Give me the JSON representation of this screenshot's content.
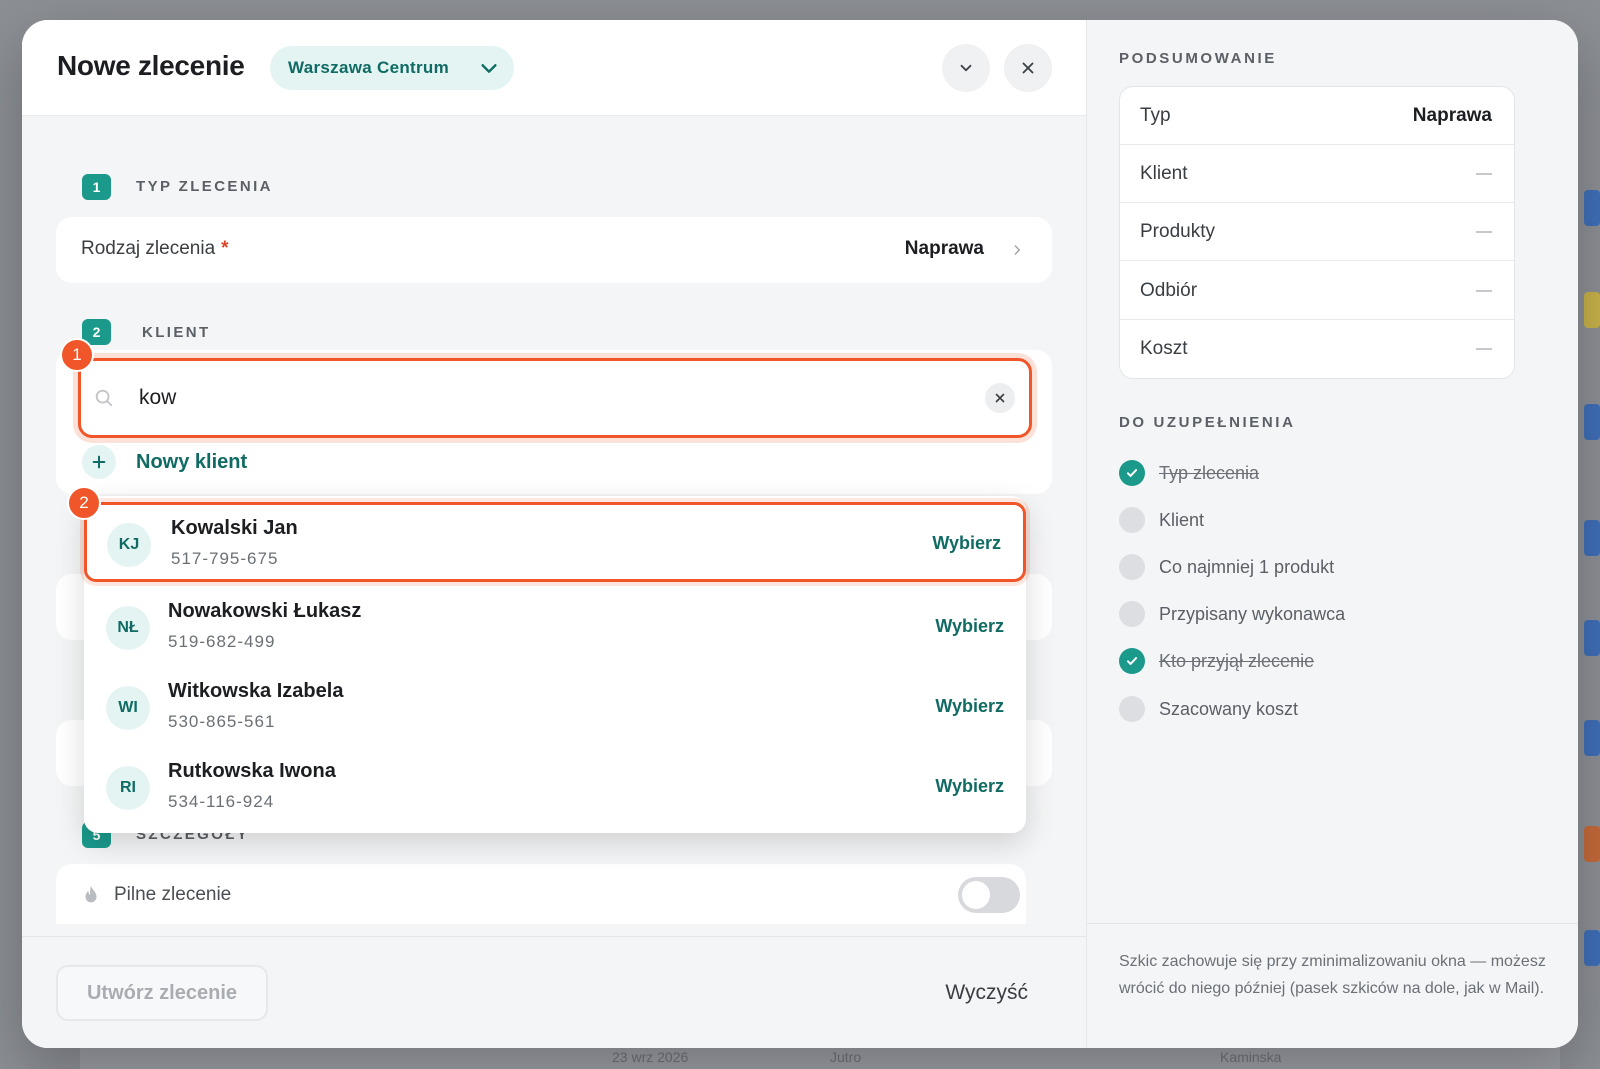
{
  "header": {
    "title": "Nowe zlecenie",
    "branch": "Warszawa Centrum"
  },
  "sections": {
    "type": {
      "num": "1",
      "label": "TYP ZLECENIA",
      "field_label": "Rodzaj zlecenia",
      "required_mark": "*",
      "value": "Naprawa"
    },
    "client": {
      "num": "2",
      "label": "KLIENT"
    },
    "details": {
      "num": "5",
      "label": "SZCZEGÓŁY"
    }
  },
  "search": {
    "value": "kow",
    "badge": "1"
  },
  "new_client_label": "Nowy klient",
  "results_badge": "2",
  "results": [
    {
      "initials": "KJ",
      "name": "Kowalski Jan",
      "phone": "517-795-675",
      "action": "Wybierz"
    },
    {
      "initials": "NŁ",
      "name": "Nowakowski Łukasz",
      "phone": "519-682-499",
      "action": "Wybierz"
    },
    {
      "initials": "WI",
      "name": "Witkowska Izabela",
      "phone": "530-865-561",
      "action": "Wybierz"
    },
    {
      "initials": "RI",
      "name": "Rutkowska Iwona",
      "phone": "534-116-924",
      "action": "Wybierz"
    }
  ],
  "urgent": {
    "label": "Pilne zlecenie",
    "enabled": false
  },
  "footer": {
    "create": "Utwórz zlecenie",
    "clear": "Wyczyść"
  },
  "summary": {
    "title": "PODSUMOWANIE",
    "rows": [
      {
        "key": "Typ",
        "value": "Naprawa"
      },
      {
        "key": "Klient",
        "value": ""
      },
      {
        "key": "Produkty",
        "value": ""
      },
      {
        "key": "Odbiór",
        "value": ""
      },
      {
        "key": "Koszt",
        "value": ""
      }
    ]
  },
  "todo": {
    "title": "DO UZUPEŁNIENIA",
    "items": [
      {
        "label": "Typ zlecenia",
        "done": true
      },
      {
        "label": "Klient",
        "done": false
      },
      {
        "label": "Co najmniej 1 produkt",
        "done": false
      },
      {
        "label": "Przypisany wykonawca",
        "done": false
      },
      {
        "label": "Kto przyjął zlecenie",
        "done": true
      },
      {
        "label": "Szacowany koszt",
        "done": false
      }
    ]
  },
  "draft_note": "Szkic zachowuje się przy zminimalizowaniu okna — możesz wrócić do niego później (pasek szkiców na dole, jak w Mail).",
  "backdrop": {
    "date": "23 wrz 2026",
    "when": "Jutro",
    "tag": "Kaminska"
  },
  "colors": {
    "accent": "#1b9a8c",
    "accent_dark": "#0f6b63",
    "highlight": "#f0562a",
    "required": "#d9482b"
  }
}
